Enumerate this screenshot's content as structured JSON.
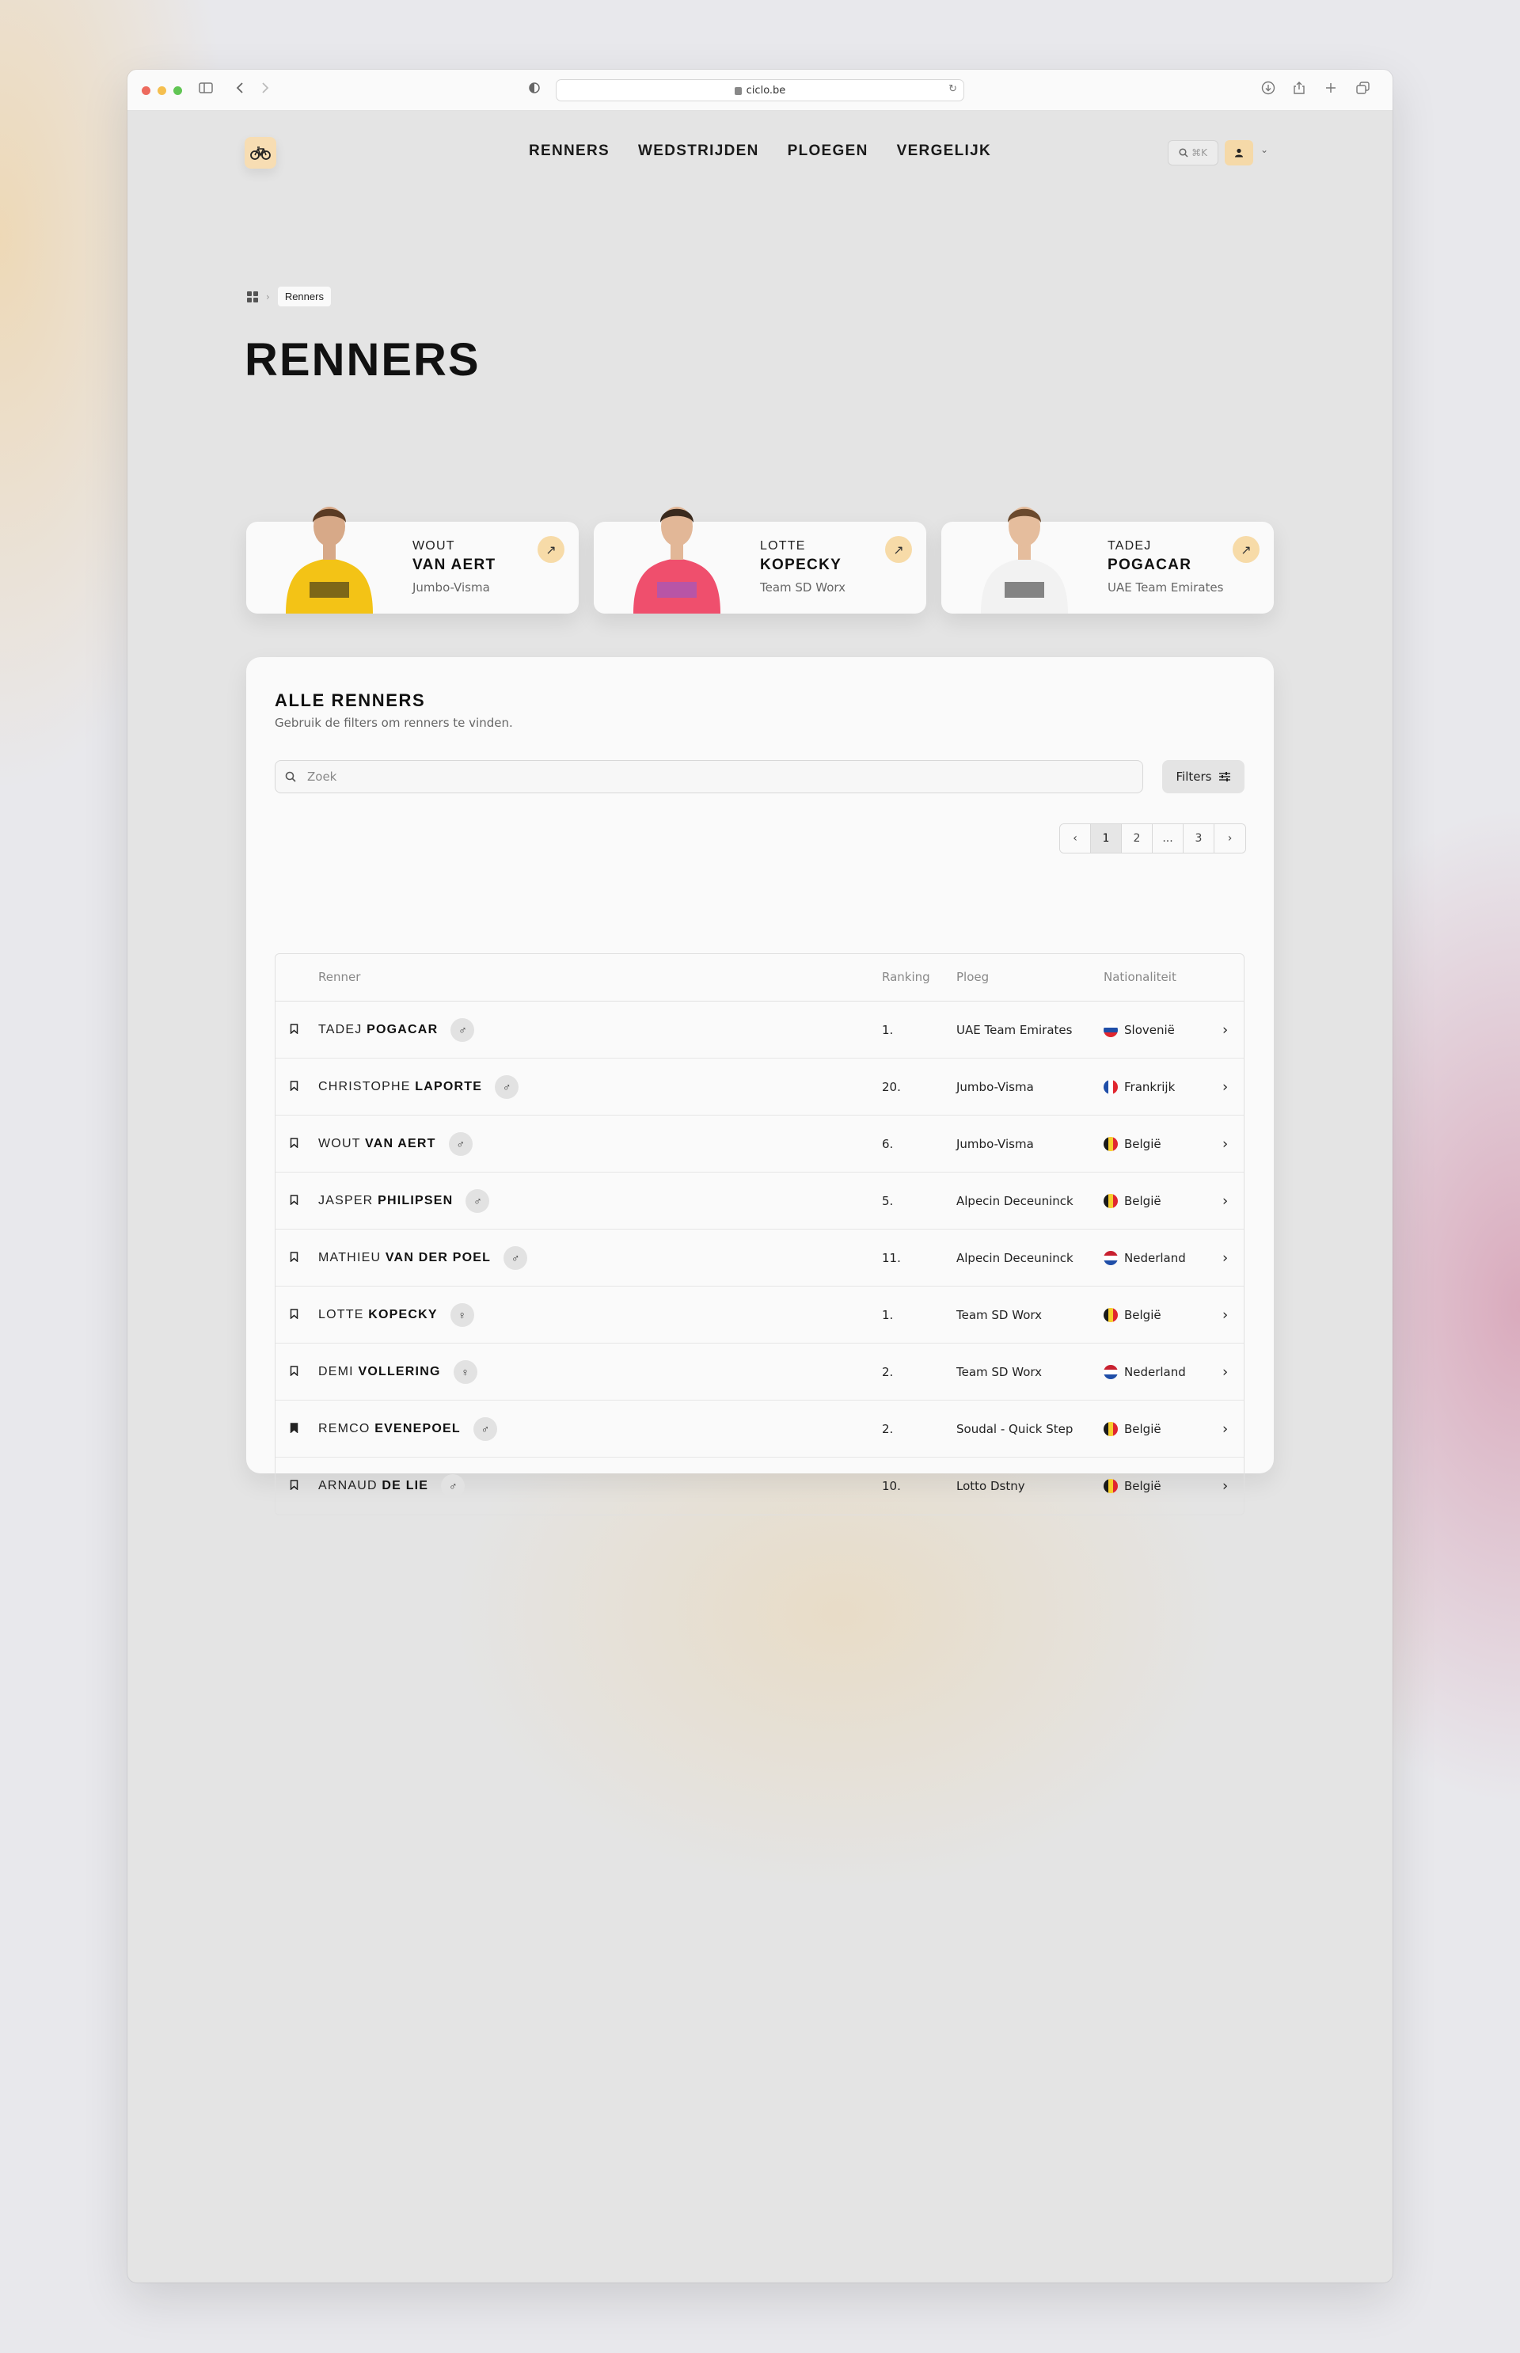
{
  "browser": {
    "url": "ciclo.be"
  },
  "nav": {
    "items": [
      "RENNERS",
      "WEDSTRIJDEN",
      "PLOEGEN",
      "VERGELIJK"
    ],
    "search_shortcut": "⌘K"
  },
  "breadcrumb": {
    "current": "Renners"
  },
  "page": {
    "title": "RENNERS"
  },
  "featured": [
    {
      "first": "WOUT",
      "last": "VAN AERT",
      "team": "Jumbo-Visma",
      "jersey": "#f3c316",
      "jersey2": "#1b1b1b",
      "skin": "#d7a988",
      "hair": "#5a3b24"
    },
    {
      "first": "LOTTE",
      "last": "KOPECKY",
      "team": "Team SD Worx",
      "jersey": "#ef4f6d",
      "jersey2": "#8a5bd6",
      "skin": "#e2b797",
      "hair": "#3a2a1e"
    },
    {
      "first": "TADEJ",
      "last": "POGACAR",
      "team": "UAE Team Emirates",
      "jersey": "#f2f2f2",
      "jersey2": "#2a2a2a",
      "skin": "#e5bd9d",
      "hair": "#6b4a2e"
    }
  ],
  "panel": {
    "title": "ALLE RENNERS",
    "subtitle": "Gebruik de filters om renners te vinden.",
    "search_placeholder": "Zoek",
    "filters_label": "Filters"
  },
  "pagination": {
    "prev": "‹",
    "pages": [
      "1",
      "2",
      "...",
      "3"
    ],
    "next": "›",
    "active": "1"
  },
  "table": {
    "headers": {
      "name": "Renner",
      "ranking": "Ranking",
      "team": "Ploeg",
      "nationality": "Nationaliteit"
    },
    "rows": [
      {
        "first": "TADEJ",
        "last": "POGACAR",
        "gender": "♂",
        "ranking": "1.",
        "team": "UAE Team Emirates",
        "nationality": "Slovenië",
        "flag": "si",
        "bookmarked": false
      },
      {
        "first": "CHRISTOPHE",
        "last": "LAPORTE",
        "gender": "♂",
        "ranking": "20.",
        "team": "Jumbo-Visma",
        "nationality": "Frankrijk",
        "flag": "fr",
        "bookmarked": false
      },
      {
        "first": "WOUT",
        "last": "VAN AERT",
        "gender": "♂",
        "ranking": "6.",
        "team": "Jumbo-Visma",
        "nationality": "België",
        "flag": "be",
        "bookmarked": false
      },
      {
        "first": "JASPER",
        "last": "PHILIPSEN",
        "gender": "♂",
        "ranking": "5.",
        "team": "Alpecin Deceuninck",
        "nationality": "België",
        "flag": "be",
        "bookmarked": false
      },
      {
        "first": "MATHIEU",
        "last": "VAN DER POEL",
        "gender": "♂",
        "ranking": "11.",
        "team": "Alpecin Deceuninck",
        "nationality": "Nederland",
        "flag": "nl",
        "bookmarked": false
      },
      {
        "first": "LOTTE",
        "last": "KOPECKY",
        "gender": "♀",
        "ranking": "1.",
        "team": "Team SD Worx",
        "nationality": "België",
        "flag": "be",
        "bookmarked": false
      },
      {
        "first": "DEMI",
        "last": "VOLLERING",
        "gender": "♀",
        "ranking": "2.",
        "team": "Team SD Worx",
        "nationality": "Nederland",
        "flag": "nl",
        "bookmarked": false
      },
      {
        "first": "REMCO",
        "last": "EVENEPOEL",
        "gender": "♂",
        "ranking": "2.",
        "team": "Soudal - Quick Step",
        "nationality": "België",
        "flag": "be",
        "bookmarked": true
      },
      {
        "first": "ARNAUD",
        "last": "DE LIE",
        "gender": "♂",
        "ranking": "10.",
        "team": "Lotto Dstny",
        "nationality": "België",
        "flag": "be",
        "bookmarked": false
      }
    ]
  },
  "colors": {
    "accent": "#f5d9a8",
    "panel": "#fafafa"
  }
}
